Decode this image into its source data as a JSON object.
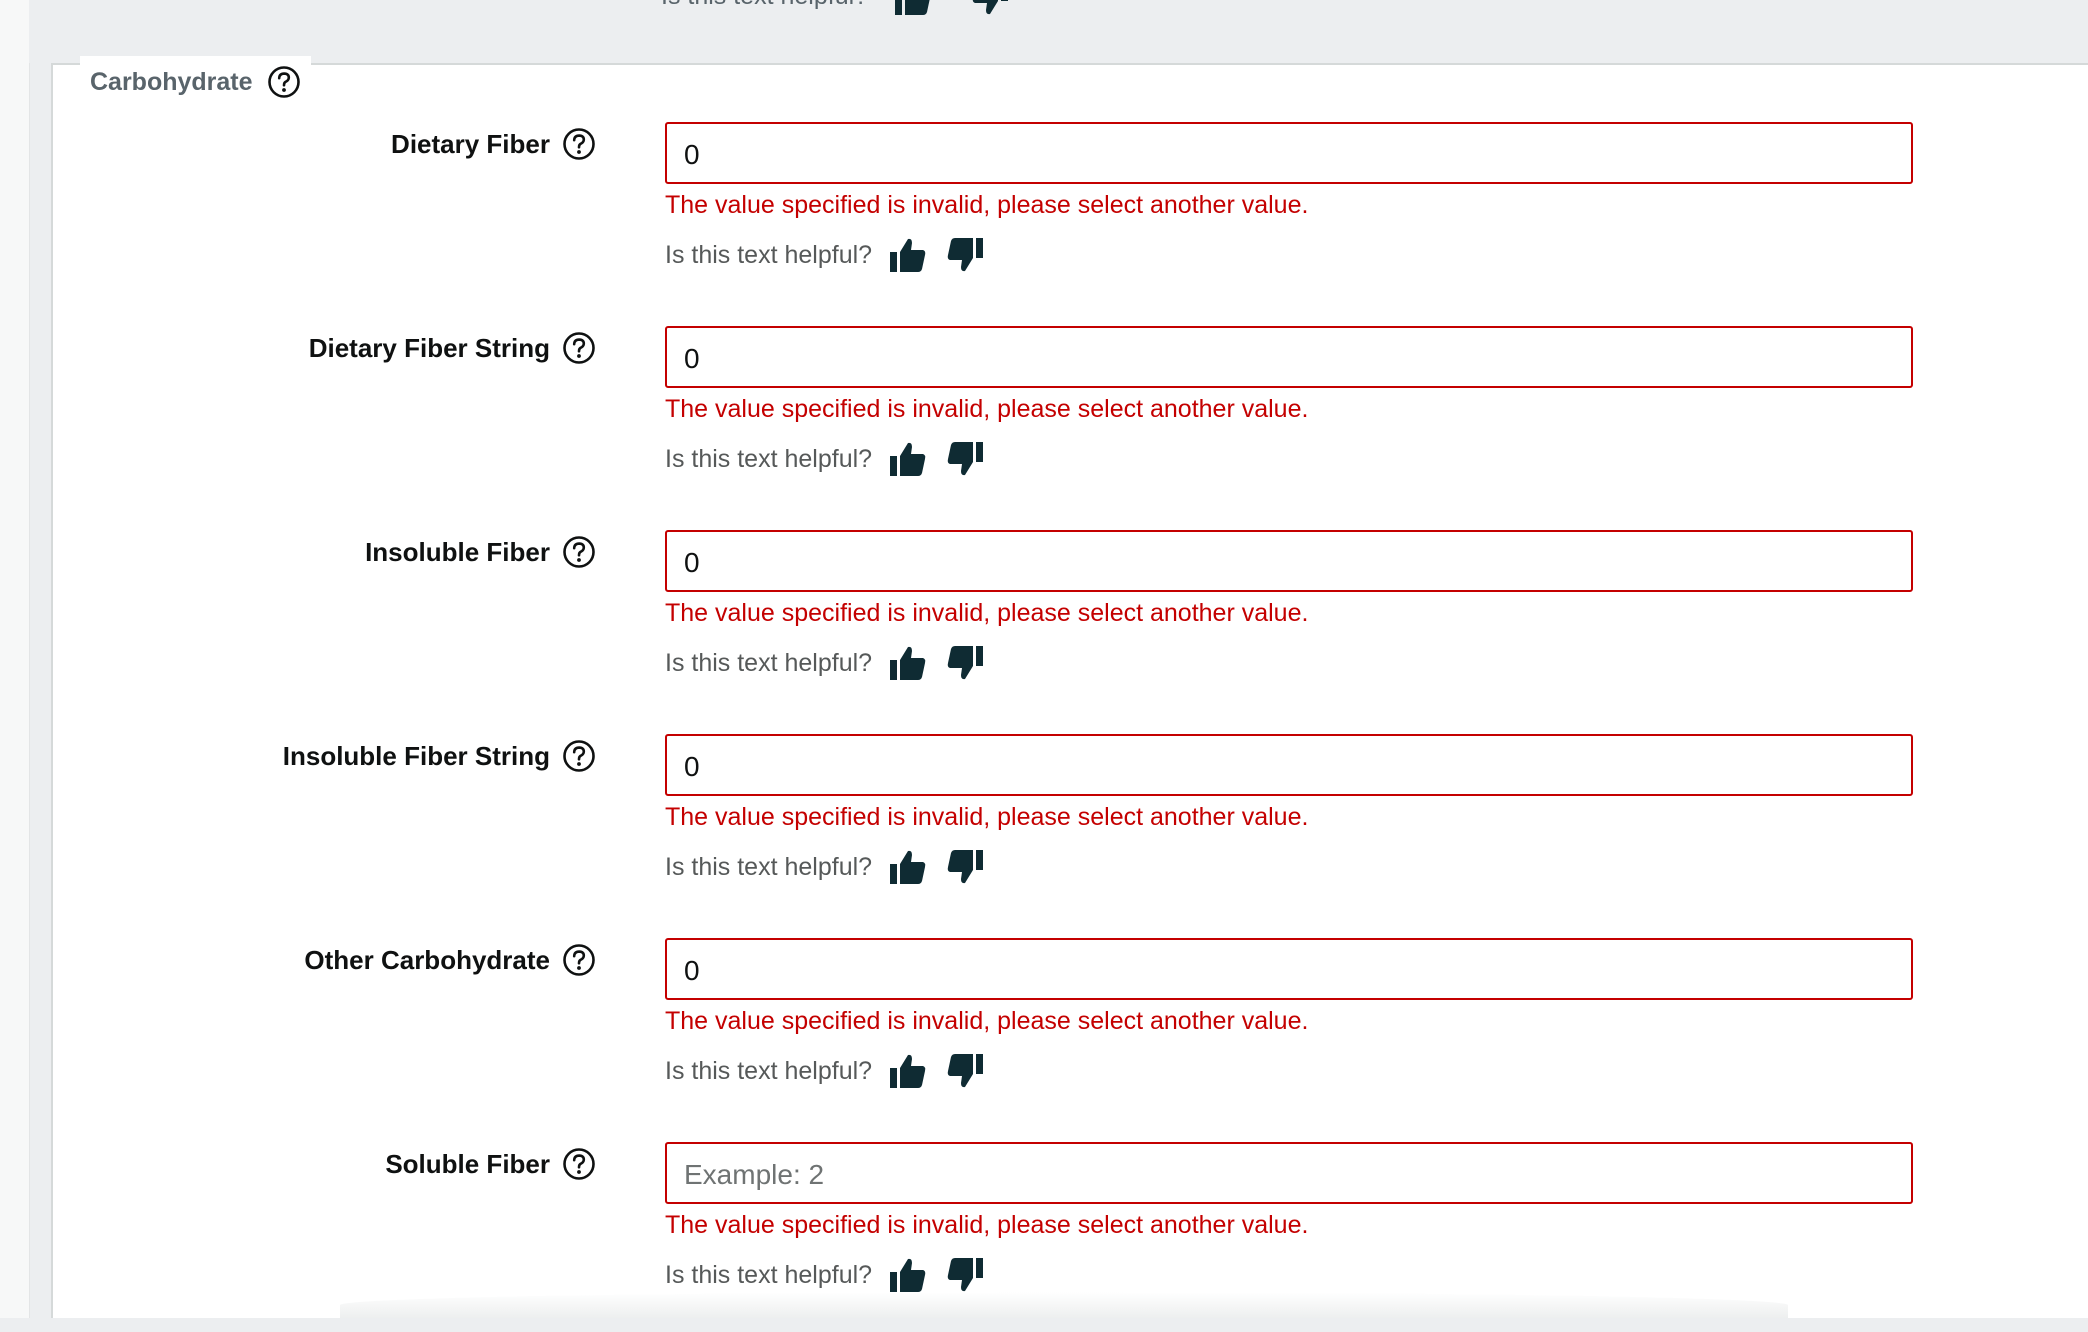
{
  "top_fragment": {
    "text": "Is this text helpful?"
  },
  "section": {
    "legend": "Carbohydrate"
  },
  "fields": [
    {
      "label": "Dietary Fiber",
      "value": "0",
      "placeholder": "",
      "error": "The value specified is invalid, please select another value.",
      "helpful": "Is this text helpful?"
    },
    {
      "label": "Dietary Fiber String",
      "value": "0",
      "placeholder": "",
      "error": "The value specified is invalid, please select another value.",
      "helpful": "Is this text helpful?"
    },
    {
      "label": "Insoluble Fiber",
      "value": "0",
      "placeholder": "",
      "error": "The value specified is invalid, please select another value.",
      "helpful": "Is this text helpful?"
    },
    {
      "label": "Insoluble Fiber String",
      "value": "0",
      "placeholder": "",
      "error": "The value specified is invalid, please select another value.",
      "helpful": "Is this text helpful?"
    },
    {
      "label": "Other Carbohydrate",
      "value": "0",
      "placeholder": "",
      "error": "The value specified is invalid, please select another value.",
      "helpful": "Is this text helpful?"
    },
    {
      "label": "Soluble Fiber",
      "value": "",
      "placeholder": "Example: 2",
      "error": "The value specified is invalid, please select another value.",
      "helpful": "Is this text helpful?"
    }
  ],
  "icons": {
    "help": "question-circle-icon",
    "thumbs_up": "thumbs-up-icon",
    "thumbs_down": "thumbs-down-icon"
  },
  "colors": {
    "error": "#c40000",
    "label": "#0f1111",
    "muted": "#565959",
    "legend": "#59646b",
    "icon_dark": "#0f2b33"
  }
}
